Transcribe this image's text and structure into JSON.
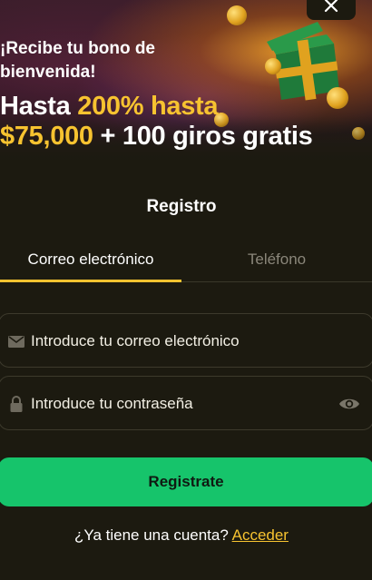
{
  "promo": {
    "subtitle": "¡Recibe tu bono de bienvenida!",
    "headline_prefix": "Hasta ",
    "headline_percent": "200% hasta",
    "headline_amount": "$75,000",
    "headline_suffix": " + 100 giros gratis",
    "accent_color": "#f7c330"
  },
  "close": {
    "icon": "close-icon"
  },
  "form": {
    "title": "Registro",
    "tabs": [
      {
        "label": "Correo electrónico",
        "active": true
      },
      {
        "label": "Teléfono",
        "active": false
      }
    ],
    "email": {
      "placeholder": "Introduce tu correo electrónico",
      "value": "",
      "icon": "envelope-icon"
    },
    "password": {
      "placeholder": "Introduce tu contraseña",
      "value": "",
      "icon": "lock-icon",
      "toggle_icon": "eye-icon"
    },
    "submit_label": "Registrate",
    "submit_color": "#16c46b"
  },
  "login": {
    "prompt": "¿Ya tiene una cuenta? ",
    "link_label": "Acceder"
  }
}
